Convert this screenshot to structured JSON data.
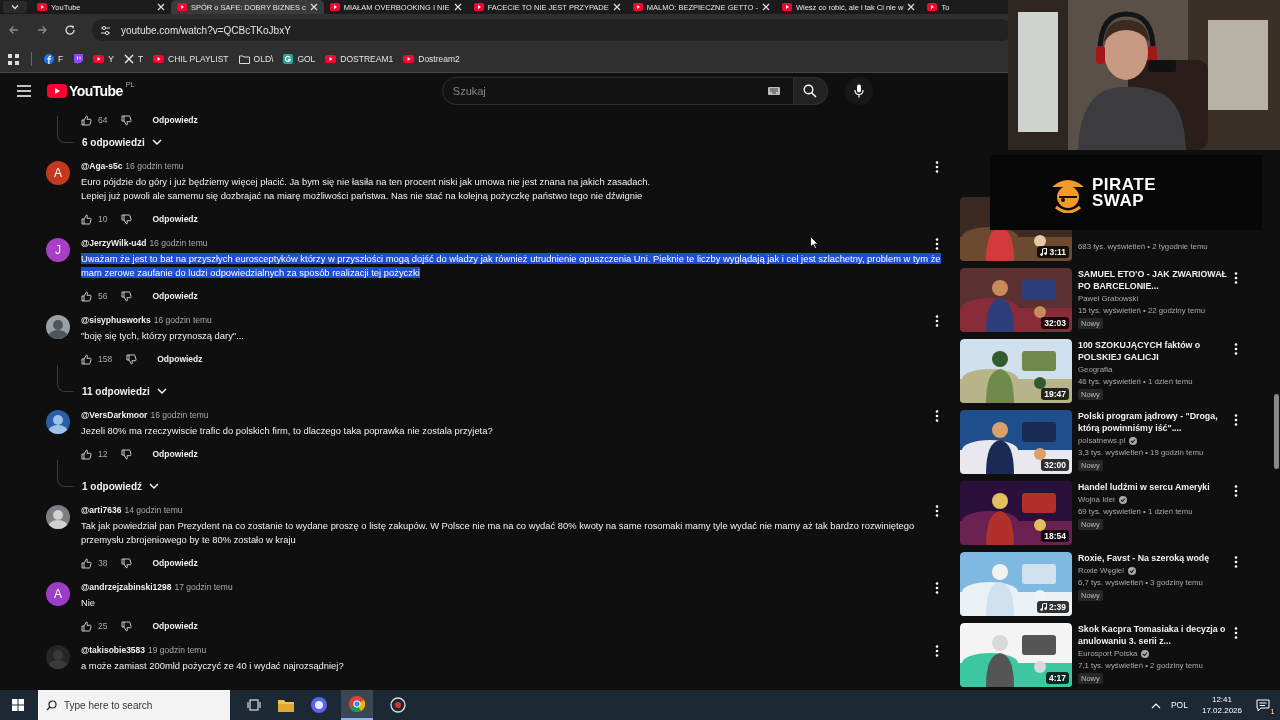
{
  "tabs": [
    {
      "title": "YouTube",
      "selected": false
    },
    {
      "title": "SPÓR o SAFE: DOBRY BIZNES c",
      "selected": true
    },
    {
      "title": "MIAŁAM OVERBOOKING I NIE",
      "selected": false
    },
    {
      "title": "FACECIE TO NIE JEST PRZYPADE",
      "selected": false
    },
    {
      "title": "MALMÖ: BEZPIECZNE GETTO -",
      "selected": false
    },
    {
      "title": "Wiesz co robić, ale i tak Ci nie w",
      "selected": false
    },
    {
      "title": "To",
      "selected": false
    }
  ],
  "address_bar": {
    "url": "youtube.com/watch?v=QCBcTKoJbxY"
  },
  "bookmarks": [
    {
      "kind": "facebook",
      "label": "F"
    },
    {
      "kind": "twitch"
    },
    {
      "kind": "youtube",
      "label": "Y"
    },
    {
      "kind": "x",
      "label": "T"
    },
    {
      "kind": "youtube",
      "label": "CHIL PLAYLIST"
    },
    {
      "kind": "folder",
      "label": "OLD\\"
    },
    {
      "kind": "g",
      "label": "GOL"
    },
    {
      "kind": "youtube",
      "label": "DOSTREAM1"
    },
    {
      "kind": "youtube",
      "label": "Dostream2"
    }
  ],
  "header": {
    "logo": "YouTube",
    "region": "PL",
    "search_placeholder": "Szukaj"
  },
  "comments": [
    {
      "kind": "actions",
      "likes": "64",
      "reply": "Odpowiedz"
    },
    {
      "kind": "replies",
      "label": "6 odpowiedzi"
    },
    {
      "kind": "comment",
      "avatar": {
        "letter": "A",
        "color": "#c4391d"
      },
      "author": "@Aga-s5c",
      "time": "16 godzin temu",
      "text": "Euro pójdzie do góry i już będziemy więcej płacić. Ja bym się nie łasiła na ten procent niski jak umowa nie jest znana na jakich zasadach.\nLepiej już powoli ale samemu się dozbrajać na miarę możliwości państwa. Nas nie stać na kolejną pożyczkę państwo tego nie dźwignie",
      "selected": false,
      "likes": "10",
      "reply": "Odpowiedz"
    },
    {
      "kind": "comment",
      "avatar": {
        "letter": "J",
        "color": "#a93fc4"
      },
      "author": "@JerzyWilk-u4d",
      "time": "16 godzin temu",
      "text": "Uważam że jest to bat na przyszłych eurosceptyków którzy w przyszłości mogą dojść do władzy jak również utrudnienie opuszczenia Uni. Pieknie te liczby wyglądają jak i cel jest szlachetny, problem w tym że mam zerowe zaufanie do ludzi odpowiedzialnych za sposób realizacji tej pożyczki",
      "selected": true,
      "likes": "56",
      "reply": "Odpowiedz"
    },
    {
      "kind": "comment",
      "author": "@sisyphusworks",
      "time": "16 godzin temu",
      "text": "\"boję się tych, którzy przynoszą dary\"...",
      "selected": false,
      "likes": "158",
      "reply": "Odpowiedz"
    },
    {
      "kind": "replies",
      "label": "11 odpowiedzi"
    },
    {
      "kind": "comment",
      "author": "@VersDarkmoor",
      "time": "16 godzin temu",
      "text": "Jezeli 80% ma rzeczywiscie trafic do polskich firm, to dlaczego taka poprawka nie zostala przyjeta?",
      "selected": false,
      "likes": "12",
      "reply": "Odpowiedz"
    },
    {
      "kind": "replies",
      "label": "1 odpowiedź"
    },
    {
      "kind": "comment",
      "author": "@arti7636",
      "time": "14 godzin temu",
      "text": "Tak jak powiedział pan Prezydent na co zostanie to wydane proszę o listę zakupów. W Polsce nie ma na co wydać 80% kwoty na same rosomaki mamy tyle wydać nie mamy aż tak bardzo rozwiniętego przemysłu zbrojeniowego by te 80% zostało w kraju",
      "selected": false,
      "likes": "38",
      "reply": "Odpowiedz"
    },
    {
      "kind": "comment",
      "avatar": {
        "letter": "A",
        "color": "#9b3dc8"
      },
      "author": "@andrzejzabinski1298",
      "time": "17 godzin temu",
      "text": "Nie",
      "selected": false,
      "likes": "25",
      "reply": "Odpowiedz"
    },
    {
      "kind": "comment",
      "author": "@takisobie3583",
      "time": "19 godzin temu",
      "text": "a może zamiast 200mld pożyczyć ze 40 i wydać najrozsądniej?",
      "selected": false
    }
  ],
  "videos": [
    {
      "duration": "3:11",
      "music": true,
      "meta": "683 tys. wyświetleń • 2 tygodnie temu"
    },
    {
      "title": "SAMUEL ETO'O - JAK ZWARIOWAŁ PO BARCELONIE...",
      "channel": "Paweł Grabowski",
      "verified": false,
      "meta": "15 tys. wyświetleń • 22 godziny temu",
      "badge": "Nowy",
      "duration": "32:03",
      "music": false
    },
    {
      "title": "100 SZOKUJĄCYCH faktów o POLSKIEJ GALICJI",
      "channel": "Geografia",
      "verified": false,
      "meta": "46 tys. wyświetleń • 1 dzień temu",
      "badge": "Nowy",
      "duration": "19:47",
      "music": false
    },
    {
      "title": "Polski program jądrowy - \"Droga, którą powinniśmy iść\"....",
      "channel": "polsatnews.pl",
      "verified": true,
      "meta": "3,3 tys. wyświetleń • 19 godzin temu",
      "badge": "Nowy",
      "duration": "32:00",
      "music": false
    },
    {
      "title": "Handel ludźmi w sercu Ameryki",
      "channel": "Wojna Idei",
      "verified": true,
      "meta": "69 tys. wyświetleń • 1 dzień temu",
      "badge": "Nowy",
      "duration": "18:54",
      "music": false
    },
    {
      "title": "Roxie, Favst - Na szeroką wodę",
      "channel": "Roxie Węgiel",
      "verified": true,
      "meta": "6,7 tys. wyświetleń • 3 godziny temu",
      "badge": "Nowy",
      "duration": "2:39",
      "music": true
    },
    {
      "title": "Skok Kacpra Tomasiaka i decyzja o anulowaniu 3. serii z...",
      "channel": "Eurosport Polska",
      "verified": true,
      "meta": "7,1 tys. wyświetleń • 2 godziny temu",
      "badge": "Nowy",
      "duration": "4:17",
      "music": false
    }
  ],
  "overlay": {
    "logo": "PIRATE SWAP"
  },
  "taskbar": {
    "search_placeholder": "Type here to search",
    "language": "POL",
    "time": "12:41",
    "date": "17.02.2026",
    "notifications": "1"
  }
}
